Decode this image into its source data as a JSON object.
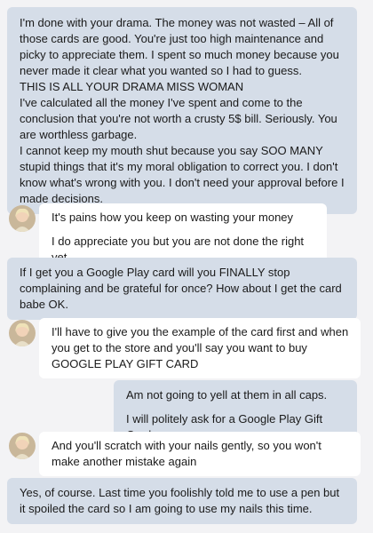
{
  "thread": {
    "m1": {
      "lines": [
        "I'm done with your drama. The money was not wasted – All of those cards are good. You're just too high maintenance and picky to appreciate them. I spent so much money because you never made it clear what you wanted so I had to guess.",
        "THIS IS ALL YOUR DRAMA MISS WOMAN",
        "I've calculated all the money I've spent and come to the conclusion that you're not worth a crusty 5$ bill. Seriously. You are worthless garbage.",
        "I cannot keep my mouth shut because you say SOO MANY stupid things that it's my moral obligation to correct you. I don't know what's wrong with you. I don't need your approval before I made decisions."
      ]
    },
    "m2": {
      "lines": [
        "It's pains how you keep on wasting your money",
        "I do appreciate you but you are not done the right yet"
      ]
    },
    "m3": {
      "lines": [
        "If I get you a Google Play card will you FINALLY stop complaining and be grateful for once? How about I get the card babe OK."
      ]
    },
    "m4": {
      "lines": [
        "I'll have to give you the example of the card first and when you get to the store and you'll say you want to buy GOOGLE PLAY GIFT CARD"
      ]
    },
    "m5": {
      "lines": [
        "Am not going to yell at them in all caps.",
        "I will politely ask for a Google Play Gift Card."
      ]
    },
    "m6": {
      "lines": [
        "And you'll scratch with your nails gently, so you won't make another mistake again"
      ]
    },
    "m7": {
      "lines": [
        "Yes, of course. Last time you foolishly told me to use a pen but it spoiled the card so I am going to use my nails this time."
      ]
    }
  },
  "colors": {
    "page_bg": "#f3f3f5",
    "outgoing_bubble": "#d5dde8",
    "incoming_bubble": "#ffffff"
  },
  "icons": {
    "avatar": "user-avatar-photo"
  }
}
